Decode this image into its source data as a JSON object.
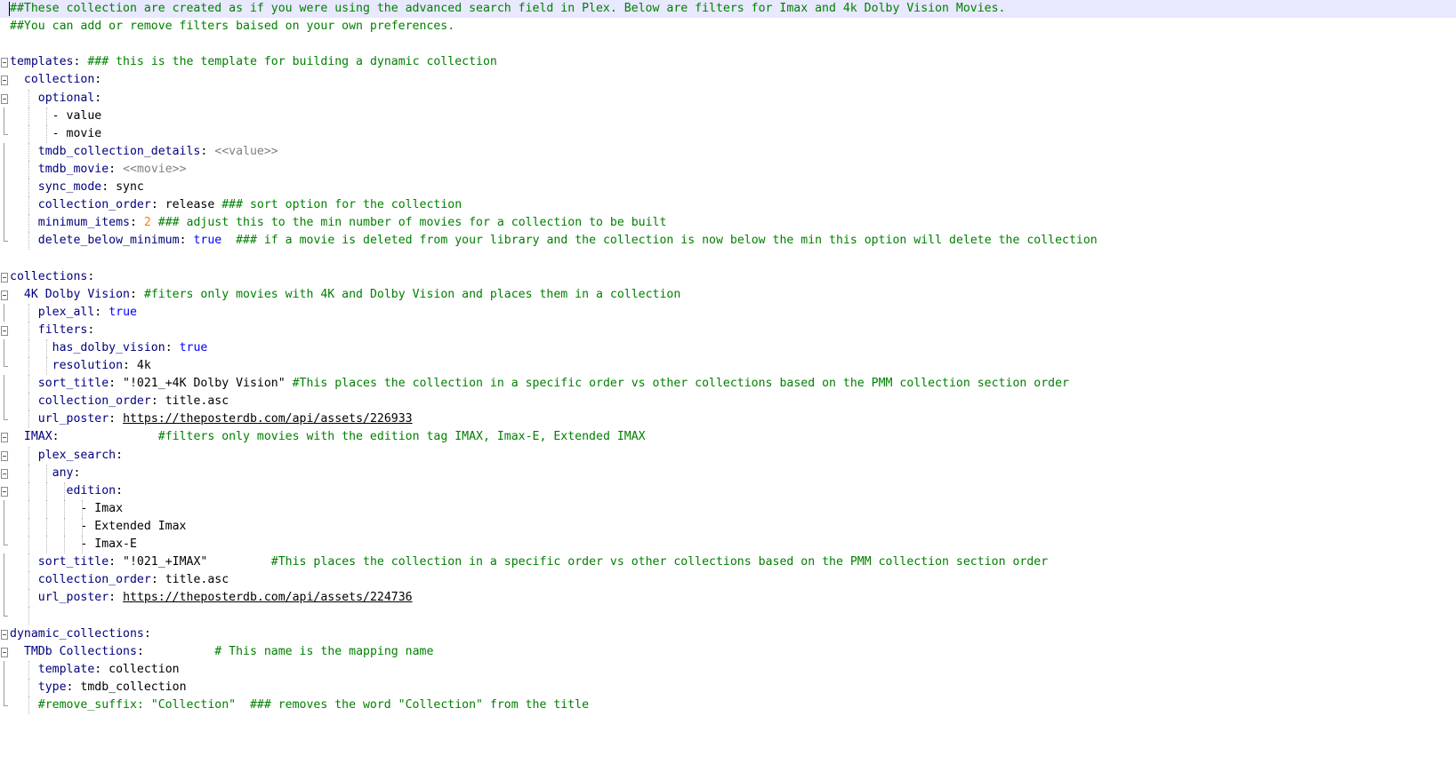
{
  "editor": {
    "language": "YAML",
    "lines": [
      {
        "fold": "none",
        "guides": [],
        "current": true,
        "tokens": [
          {
            "t": "cmt",
            "v": "##These collection are created as if you were using the advanced search field in Plex. Below are filters for Imax and 4k Dolby Vision Movies."
          }
        ]
      },
      {
        "fold": "none",
        "guides": [],
        "tokens": [
          {
            "t": "cmt",
            "v": "##You can add or remove filters baised on your own preferences."
          }
        ]
      },
      {
        "fold": "none",
        "guides": [],
        "tokens": []
      },
      {
        "fold": "box",
        "guides": [],
        "tokens": [
          {
            "t": "key",
            "v": "templates"
          },
          {
            "t": "val",
            "v": ": "
          },
          {
            "t": "cmt",
            "v": "### this is the template for building a dynamic collection"
          }
        ]
      },
      {
        "fold": "box",
        "guides": [],
        "tokens": [
          {
            "t": "val",
            "v": "  "
          },
          {
            "t": "key",
            "v": "collection"
          },
          {
            "t": "val",
            "v": ":"
          }
        ]
      },
      {
        "fold": "box",
        "guides": [
          2
        ],
        "tokens": [
          {
            "t": "val",
            "v": "    "
          },
          {
            "t": "key",
            "v": "optional"
          },
          {
            "t": "val",
            "v": ":"
          }
        ]
      },
      {
        "fold": "vline",
        "guides": [
          2,
          4
        ],
        "tokens": [
          {
            "t": "val",
            "v": "      - value"
          }
        ]
      },
      {
        "fold": "end",
        "guides": [
          2,
          4
        ],
        "tokens": [
          {
            "t": "val",
            "v": "      - movie"
          }
        ]
      },
      {
        "fold": "vline",
        "guides": [
          2
        ],
        "tokens": [
          {
            "t": "val",
            "v": "    "
          },
          {
            "t": "key",
            "v": "tmdb_collection_details"
          },
          {
            "t": "val",
            "v": ": "
          },
          {
            "t": "var",
            "v": "<<value>>"
          }
        ]
      },
      {
        "fold": "vline",
        "guides": [
          2
        ],
        "tokens": [
          {
            "t": "val",
            "v": "    "
          },
          {
            "t": "key",
            "v": "tmdb_movie"
          },
          {
            "t": "val",
            "v": ": "
          },
          {
            "t": "var",
            "v": "<<movie>>"
          }
        ]
      },
      {
        "fold": "vline",
        "guides": [
          2
        ],
        "tokens": [
          {
            "t": "val",
            "v": "    "
          },
          {
            "t": "key",
            "v": "sync_mode"
          },
          {
            "t": "val",
            "v": ": sync"
          }
        ]
      },
      {
        "fold": "vline",
        "guides": [
          2
        ],
        "tokens": [
          {
            "t": "val",
            "v": "    "
          },
          {
            "t": "key",
            "v": "collection_order"
          },
          {
            "t": "val",
            "v": ": release "
          },
          {
            "t": "cmt",
            "v": "### sort option for the collection"
          }
        ]
      },
      {
        "fold": "vline",
        "guides": [
          2
        ],
        "tokens": [
          {
            "t": "val",
            "v": "    "
          },
          {
            "t": "key",
            "v": "minimum_items"
          },
          {
            "t": "val",
            "v": ": "
          },
          {
            "t": "num",
            "v": "2"
          },
          {
            "t": "val",
            "v": " "
          },
          {
            "t": "cmt",
            "v": "### adjust this to the min number of movies for a collection to be built"
          }
        ]
      },
      {
        "fold": "end",
        "guides": [
          2
        ],
        "tokens": [
          {
            "t": "val",
            "v": "    "
          },
          {
            "t": "key",
            "v": "delete_below_minimum"
          },
          {
            "t": "val",
            "v": ": "
          },
          {
            "t": "bool",
            "v": "true"
          },
          {
            "t": "val",
            "v": "  "
          },
          {
            "t": "cmt",
            "v": "### if a movie is deleted from your library and the collection is now below the min this option will delete the collection"
          }
        ]
      },
      {
        "fold": "none",
        "guides": [],
        "tokens": []
      },
      {
        "fold": "box",
        "guides": [],
        "tokens": [
          {
            "t": "key",
            "v": "collections"
          },
          {
            "t": "val",
            "v": ":"
          }
        ]
      },
      {
        "fold": "box",
        "guides": [],
        "tokens": [
          {
            "t": "val",
            "v": "  "
          },
          {
            "t": "key",
            "v": "4K Dolby Vision"
          },
          {
            "t": "val",
            "v": ": "
          },
          {
            "t": "cmt",
            "v": "#fiters only movies with 4K and Dolby Vision and places them in a collection"
          }
        ]
      },
      {
        "fold": "vline",
        "guides": [
          2
        ],
        "tokens": [
          {
            "t": "val",
            "v": "    "
          },
          {
            "t": "key",
            "v": "plex_all"
          },
          {
            "t": "val",
            "v": ": "
          },
          {
            "t": "bool",
            "v": "true"
          }
        ]
      },
      {
        "fold": "box",
        "guides": [
          2
        ],
        "tokens": [
          {
            "t": "val",
            "v": "    "
          },
          {
            "t": "key",
            "v": "filters"
          },
          {
            "t": "val",
            "v": ":"
          }
        ]
      },
      {
        "fold": "vline",
        "guides": [
          2,
          4
        ],
        "tokens": [
          {
            "t": "val",
            "v": "      "
          },
          {
            "t": "key",
            "v": "has_dolby_vision"
          },
          {
            "t": "val",
            "v": ": "
          },
          {
            "t": "bool",
            "v": "true"
          }
        ]
      },
      {
        "fold": "end",
        "guides": [
          2,
          4
        ],
        "tokens": [
          {
            "t": "val",
            "v": "      "
          },
          {
            "t": "key",
            "v": "resolution"
          },
          {
            "t": "val",
            "v": ": 4k"
          }
        ]
      },
      {
        "fold": "vline",
        "guides": [
          2
        ],
        "tokens": [
          {
            "t": "val",
            "v": "    "
          },
          {
            "t": "key",
            "v": "sort_title"
          },
          {
            "t": "val",
            "v": ": \"!021_+4K Dolby Vision\" "
          },
          {
            "t": "cmt",
            "v": "#This places the collection in a specific order vs other collections based on the PMM collection section order"
          }
        ]
      },
      {
        "fold": "vline",
        "guides": [
          2
        ],
        "tokens": [
          {
            "t": "val",
            "v": "    "
          },
          {
            "t": "key",
            "v": "collection_order"
          },
          {
            "t": "val",
            "v": ": title.asc"
          }
        ]
      },
      {
        "fold": "end",
        "guides": [
          2
        ],
        "tokens": [
          {
            "t": "val",
            "v": "    "
          },
          {
            "t": "key",
            "v": "url_poster"
          },
          {
            "t": "val",
            "v": ": "
          },
          {
            "t": "url",
            "v": "https://theposterdb.com/api/assets/226933"
          }
        ]
      },
      {
        "fold": "box",
        "guides": [],
        "tokens": [
          {
            "t": "val",
            "v": "  "
          },
          {
            "t": "key",
            "v": "IMAX"
          },
          {
            "t": "val",
            "v": ":              "
          },
          {
            "t": "cmt",
            "v": "#filters only movies with the edition tag IMAX, Imax-E, Extended IMAX"
          }
        ]
      },
      {
        "fold": "box",
        "guides": [
          2
        ],
        "tokens": [
          {
            "t": "val",
            "v": "    "
          },
          {
            "t": "key",
            "v": "plex_search"
          },
          {
            "t": "val",
            "v": ":"
          }
        ]
      },
      {
        "fold": "box",
        "guides": [
          2,
          4
        ],
        "tokens": [
          {
            "t": "val",
            "v": "      "
          },
          {
            "t": "key",
            "v": "any"
          },
          {
            "t": "val",
            "v": ":"
          }
        ]
      },
      {
        "fold": "box",
        "guides": [
          2,
          4,
          6
        ],
        "tokens": [
          {
            "t": "val",
            "v": "        "
          },
          {
            "t": "key",
            "v": "edition"
          },
          {
            "t": "val",
            "v": ":"
          }
        ]
      },
      {
        "fold": "vline",
        "guides": [
          2,
          4,
          6,
          8
        ],
        "tokens": [
          {
            "t": "val",
            "v": "          - Imax"
          }
        ]
      },
      {
        "fold": "vline",
        "guides": [
          2,
          4,
          6,
          8
        ],
        "tokens": [
          {
            "t": "val",
            "v": "          - Extended Imax"
          }
        ]
      },
      {
        "fold": "end",
        "guides": [
          2,
          4,
          6,
          8
        ],
        "tokens": [
          {
            "t": "val",
            "v": "          - Imax-E"
          }
        ]
      },
      {
        "fold": "vline",
        "guides": [
          2
        ],
        "tokens": [
          {
            "t": "val",
            "v": "    "
          },
          {
            "t": "key",
            "v": "sort_title"
          },
          {
            "t": "val",
            "v": ": \"!021_+IMAX\"         "
          },
          {
            "t": "cmt",
            "v": "#This places the collection in a specific order vs other collections based on the PMM collection section order"
          }
        ]
      },
      {
        "fold": "vline",
        "guides": [
          2
        ],
        "tokens": [
          {
            "t": "val",
            "v": "    "
          },
          {
            "t": "key",
            "v": "collection_order"
          },
          {
            "t": "val",
            "v": ": title.asc"
          }
        ]
      },
      {
        "fold": "vline",
        "guides": [
          2
        ],
        "tokens": [
          {
            "t": "val",
            "v": "    "
          },
          {
            "t": "key",
            "v": "url_poster"
          },
          {
            "t": "val",
            "v": ": "
          },
          {
            "t": "url",
            "v": "https://theposterdb.com/api/assets/224736"
          }
        ]
      },
      {
        "fold": "end",
        "guides": [
          2
        ],
        "tokens": []
      },
      {
        "fold": "box",
        "guides": [],
        "tokens": [
          {
            "t": "key",
            "v": "dynamic_collections"
          },
          {
            "t": "val",
            "v": ":"
          }
        ]
      },
      {
        "fold": "box",
        "guides": [],
        "tokens": [
          {
            "t": "val",
            "v": "  "
          },
          {
            "t": "key",
            "v": "TMDb Collections"
          },
          {
            "t": "val",
            "v": ":          "
          },
          {
            "t": "cmt",
            "v": "# This name is the mapping name"
          }
        ]
      },
      {
        "fold": "vline",
        "guides": [
          2
        ],
        "tokens": [
          {
            "t": "val",
            "v": "    "
          },
          {
            "t": "key",
            "v": "template"
          },
          {
            "t": "val",
            "v": ": collection"
          }
        ]
      },
      {
        "fold": "vline",
        "guides": [
          2
        ],
        "tokens": [
          {
            "t": "val",
            "v": "    "
          },
          {
            "t": "key",
            "v": "type"
          },
          {
            "t": "val",
            "v": ": tmdb_collection"
          }
        ]
      },
      {
        "fold": "end",
        "guides": [
          2
        ],
        "tokens": [
          {
            "t": "val",
            "v": "    "
          },
          {
            "t": "cmt",
            "v": "#remove_suffix: \"Collection\"  ### removes the word \"Collection\" from the title"
          }
        ]
      }
    ]
  }
}
